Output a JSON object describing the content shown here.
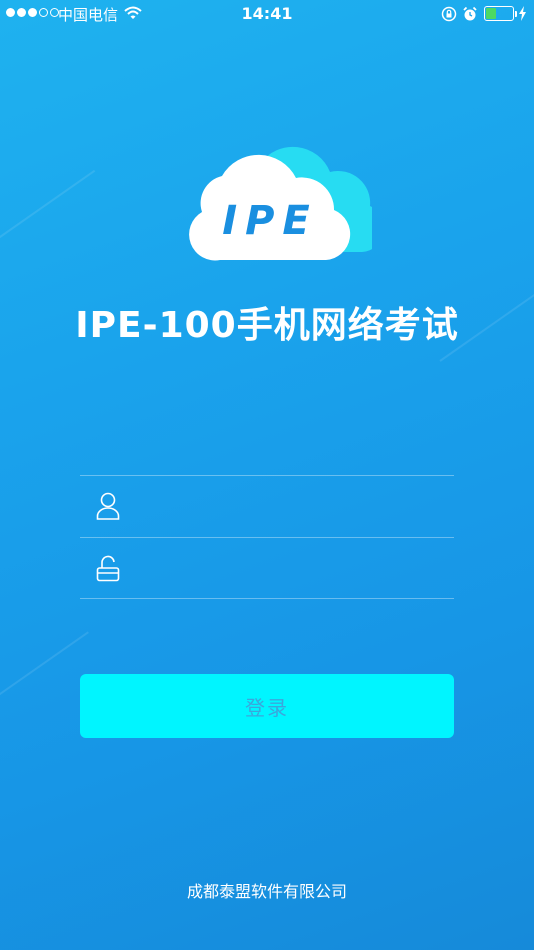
{
  "status_bar": {
    "carrier": "中国电信",
    "time": "14:41",
    "battery_level": 0.35,
    "signal_strength": 3,
    "signal_max": 5,
    "icons": [
      "signal-dots-icon",
      "wifi-icon",
      "rotation-lock-icon",
      "alarm-icon",
      "battery-icon",
      "charging-bolt-icon"
    ]
  },
  "logo": {
    "text": "IPE"
  },
  "app": {
    "title": "IPE-100手机网络考试"
  },
  "form": {
    "username": {
      "value": "",
      "placeholder": "",
      "icon": "user-icon"
    },
    "password": {
      "value": "",
      "placeholder": "",
      "icon": "unlock-icon"
    },
    "login_label": "登录"
  },
  "footer": {
    "company": "成都泰盟软件有限公司"
  },
  "colors": {
    "background": "#1aa3ec",
    "button": "#00f5ff",
    "button_text": "#3aa7dc",
    "battery_fill": "#4cd964"
  }
}
